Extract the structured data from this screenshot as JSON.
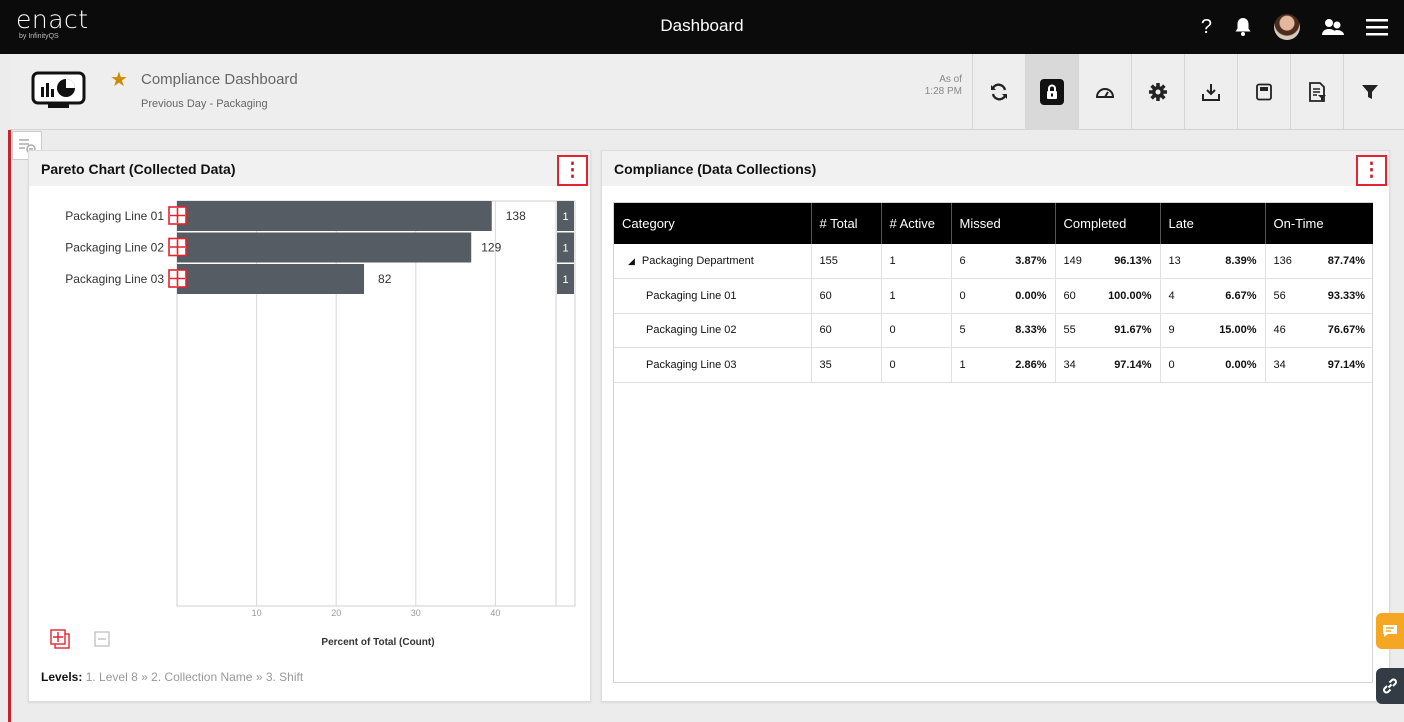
{
  "app": {
    "logo": "enact",
    "logo_sub": "by InfinityQS",
    "title": "Dashboard"
  },
  "header": {
    "dashboard_title": "Compliance Dashboard",
    "dashboard_subtitle": "Previous Day - Packaging",
    "as_of_label": "As of",
    "as_of_time": "1:28 PM",
    "star_color": "#d08a00"
  },
  "top_icons": [
    "help-icon",
    "bell-icon",
    "avatar",
    "users-icon",
    "menu-icon"
  ],
  "toolbar_icons": [
    "refresh-icon",
    "lock-icon",
    "gauge-icon",
    "gear-icon",
    "download-icon",
    "save-icon",
    "report-icon",
    "filter-icon"
  ],
  "pareto": {
    "title": "Pareto Chart (Collected Data)",
    "levels_label": "Levels:",
    "levels": [
      "1. Level 8",
      "2. Collection Name",
      "3. Shift"
    ],
    "levels_separator": "»",
    "chart_data": {
      "type": "bar",
      "orientation": "horizontal",
      "categories": [
        "Packaging Line 01",
        "Packaging Line 02",
        "Packaging Line 03"
      ],
      "values": [
        138,
        129,
        82
      ],
      "right_labels": [
        "1",
        "1",
        "1"
      ],
      "xlabel": "Percent of Total (Count)",
      "xticks": [
        10,
        20,
        30,
        40
      ],
      "xlim": [
        0,
        50
      ],
      "bar_color": "#555c63",
      "grid": true
    }
  },
  "compliance": {
    "title": "Compliance (Data Collections)",
    "columns": [
      "Category",
      "# Total",
      "# Active",
      "Missed",
      "Completed",
      "Late",
      "On-Time"
    ],
    "rows": [
      {
        "category": "Packaging Department",
        "expand": "◢",
        "total": "155",
        "active": "1",
        "missed": "6",
        "missed_pct": "3.87%",
        "completed": "149",
        "completed_pct": "96.13%",
        "late": "13",
        "late_pct": "8.39%",
        "ontime": "136",
        "ontime_pct": "87.74%"
      },
      {
        "category": "Packaging Line 01",
        "total": "60",
        "active": "1",
        "missed": "0",
        "missed_pct": "0.00%",
        "completed": "60",
        "completed_pct": "100.00%",
        "late": "4",
        "late_pct": "6.67%",
        "ontime": "56",
        "ontime_pct": "93.33%"
      },
      {
        "category": "Packaging Line 02",
        "total": "60",
        "active": "0",
        "missed": "5",
        "missed_pct": "8.33%",
        "completed": "55",
        "completed_pct": "91.67%",
        "late": "9",
        "late_pct": "15.00%",
        "ontime": "46",
        "ontime_pct": "76.67%"
      },
      {
        "category": "Packaging Line 03",
        "total": "35",
        "active": "0",
        "missed": "1",
        "missed_pct": "2.86%",
        "completed": "34",
        "completed_pct": "97.14%",
        "late": "0",
        "late_pct": "0.00%",
        "ontime": "34",
        "ontime_pct": "97.14%"
      }
    ]
  },
  "accent_red": "#e3232d",
  "side_tabs": {
    "chat_color": "#f5a623",
    "link_color": "#333b44"
  }
}
